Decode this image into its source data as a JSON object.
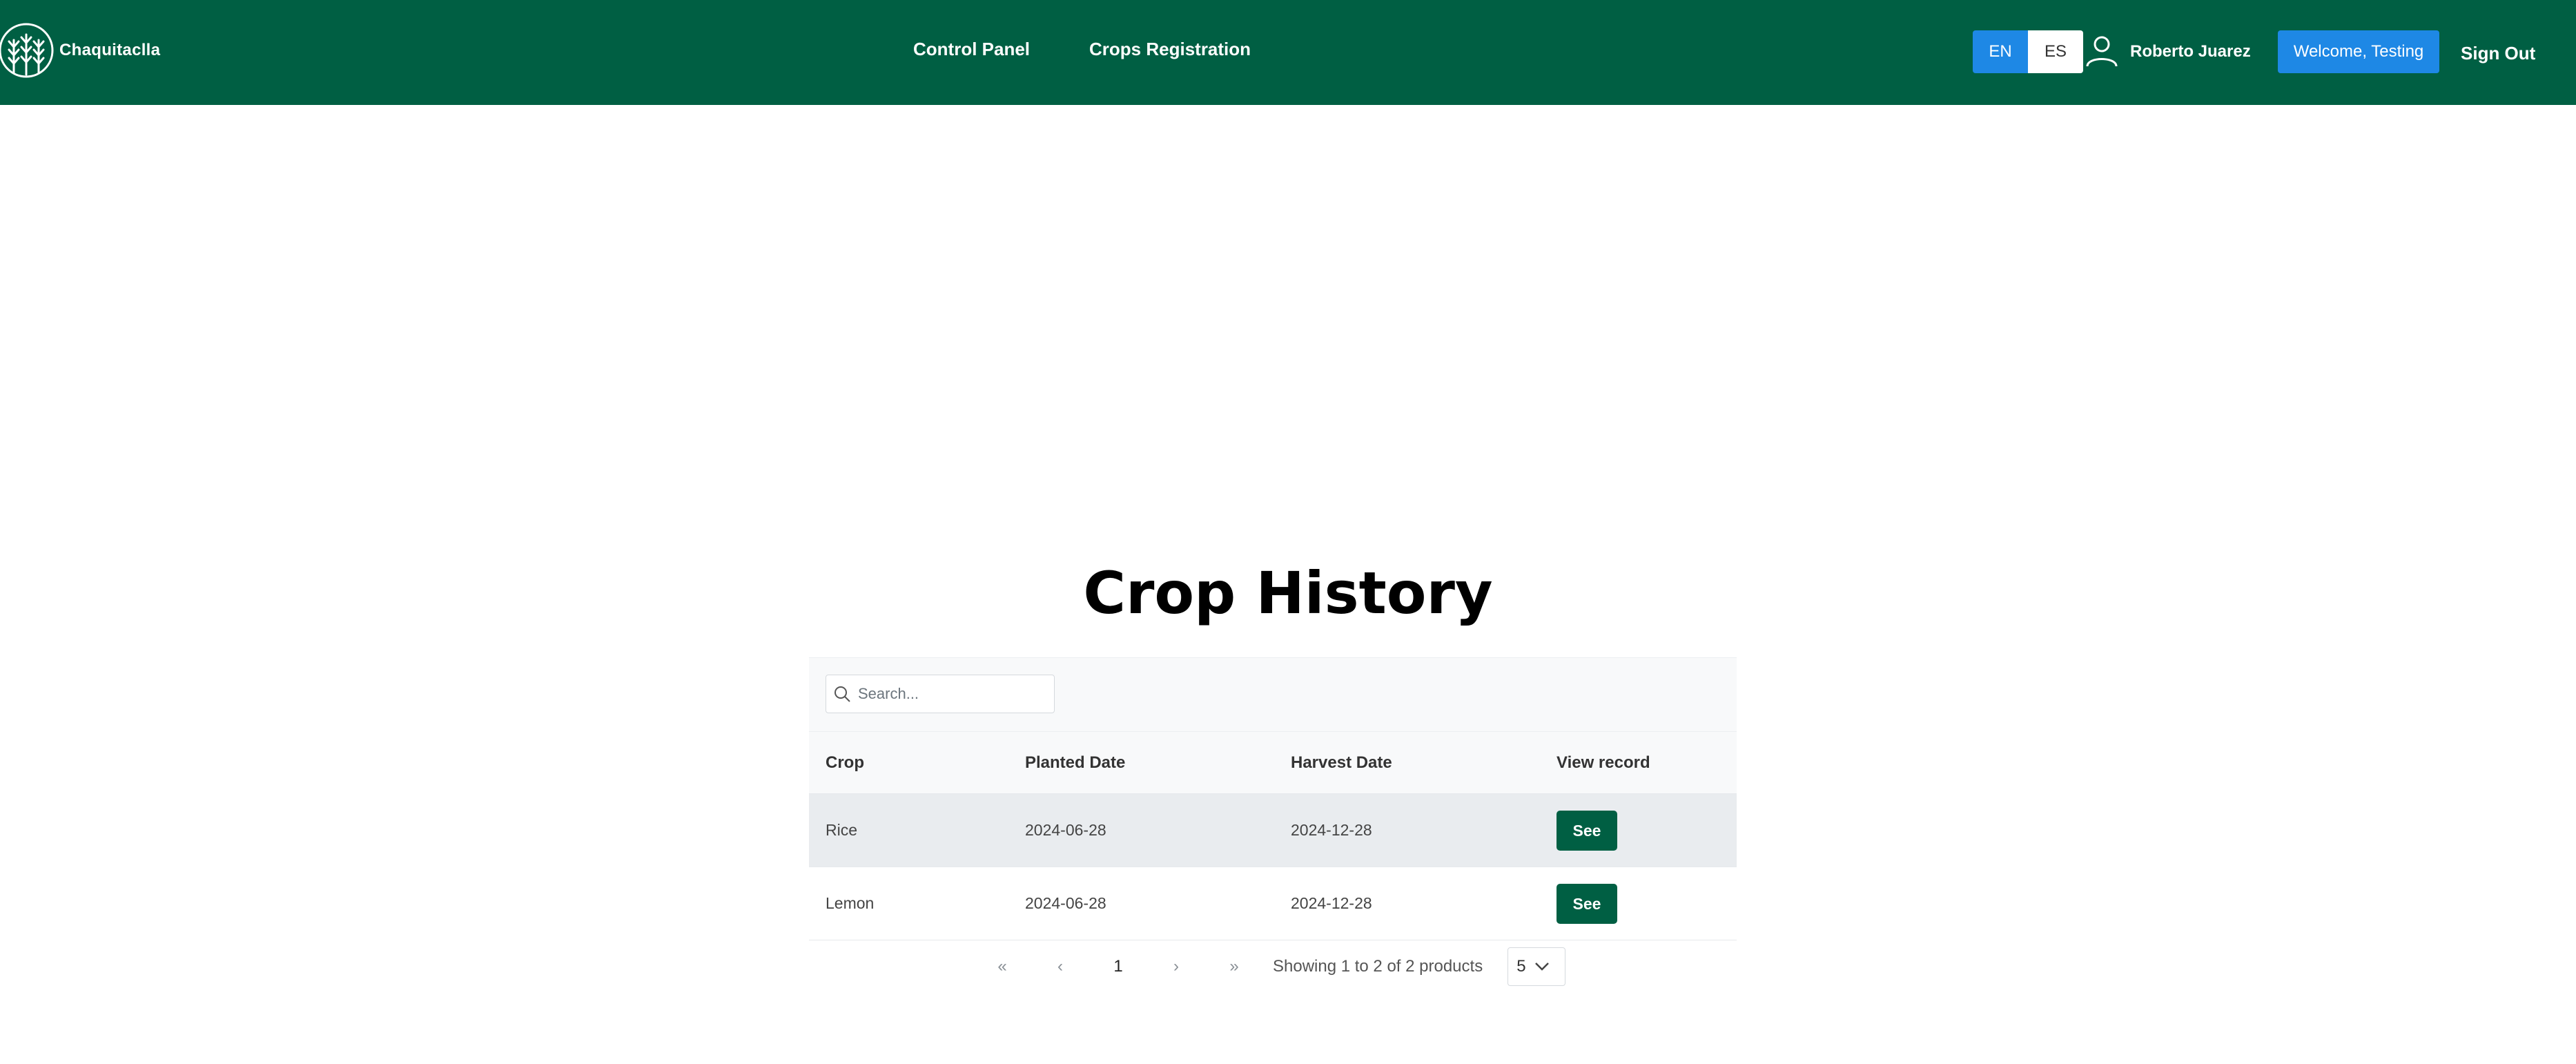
{
  "brand": {
    "name": "Chaquitaclla"
  },
  "nav": {
    "items": [
      "Control Panel",
      "Crops Registration"
    ]
  },
  "lang": {
    "en": "EN",
    "es": "ES",
    "active": "EN"
  },
  "user": {
    "name": "Roberto Juarez"
  },
  "welcome_label": "Welcome, Testing",
  "signout_label": "Sign Out",
  "page": {
    "title": "Crop History"
  },
  "search": {
    "placeholder": "Search..."
  },
  "table": {
    "headers": [
      "Crop",
      "Planted Date",
      "Harvest Date",
      "View record"
    ],
    "rows": [
      {
        "crop": "Rice",
        "planted": "2024-06-28",
        "harvest": "2024-12-28",
        "action": "See"
      },
      {
        "crop": "Lemon",
        "planted": "2024-06-28",
        "harvest": "2024-12-28",
        "action": "See"
      }
    ]
  },
  "pagination": {
    "first": "«",
    "prev": "‹",
    "current": "1",
    "next": "›",
    "last": "»",
    "info": "Showing 1 to 2 of 2 products",
    "page_size": "5"
  },
  "colors": {
    "header": "#005f43",
    "accent": "#1e88e5",
    "button": "#005f43"
  }
}
